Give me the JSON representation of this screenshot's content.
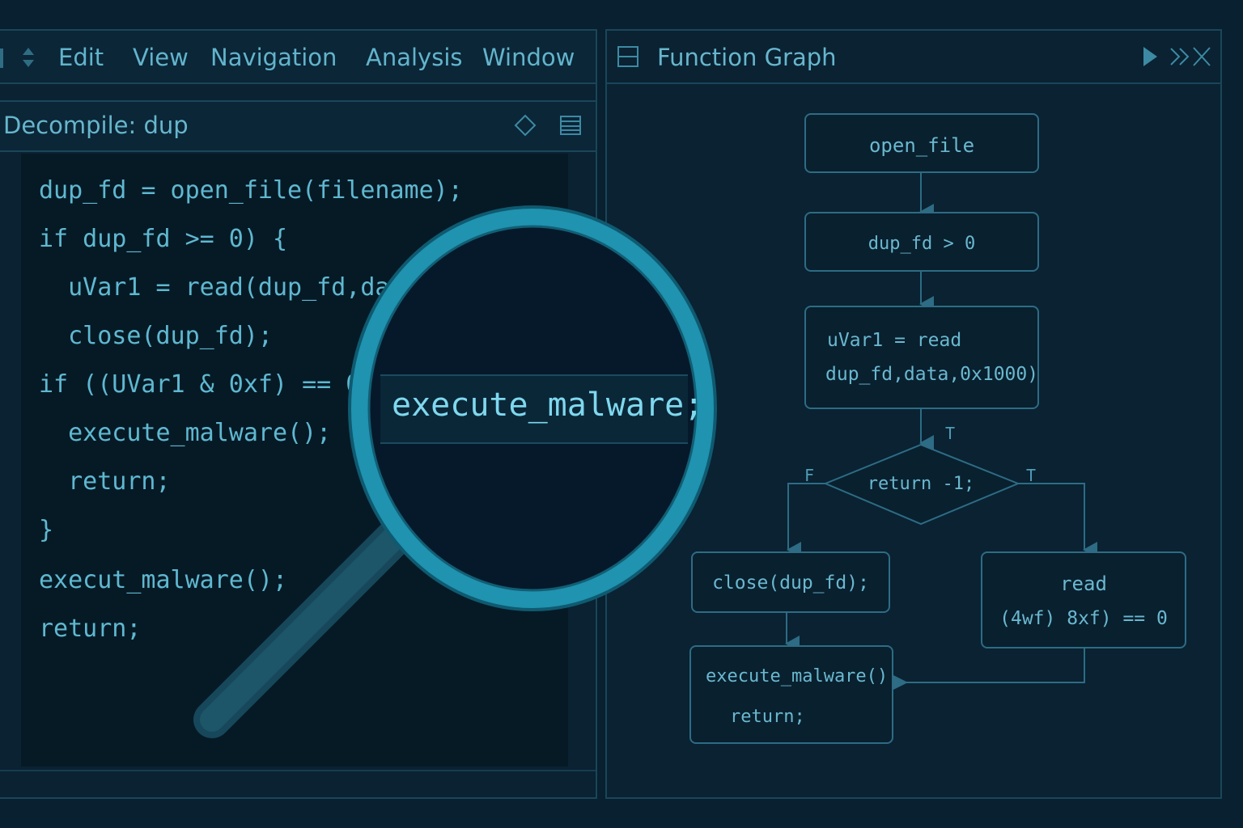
{
  "menubar": {
    "items": [
      "Edit",
      "View",
      "Navigation",
      "Analysis",
      "Window"
    ]
  },
  "decompiler": {
    "title": "Decompile: dup",
    "code_lines": [
      "dup_fd = open_file(filename);",
      "if dup_fd >= 0) {",
      "  uVar1 = read(dup_fd,da",
      "  close(dup_fd);",
      "if ((UVar1 & 0xf) == 0d",
      "  execute_malware();",
      "  return;",
      "}",
      "execut_malware();",
      "return;"
    ]
  },
  "magnifier": {
    "text": "execute_malware;"
  },
  "graph": {
    "title": "Function Graph",
    "nodes": {
      "open_file": "open_file",
      "check": "dup_fd > 0",
      "read_line1": "uVar1 = read",
      "read_line2": "dup_fd,data,0x1000)",
      "decision": "return -1;",
      "close": "close(dup_fd);",
      "read_right_line1": "read",
      "read_right_line2": "(4wf) 8xf) == 0",
      "exec_line1": "execute_malware()",
      "exec_line2": "return;"
    },
    "edge_labels": {
      "true_top": "T",
      "false_left": "F",
      "true_right": "T"
    }
  },
  "colors": {
    "background": "#08202f",
    "panel": "#0a2232",
    "border": "#1a4659",
    "text": "#5fb6cf",
    "accent": "#1f93b0"
  }
}
